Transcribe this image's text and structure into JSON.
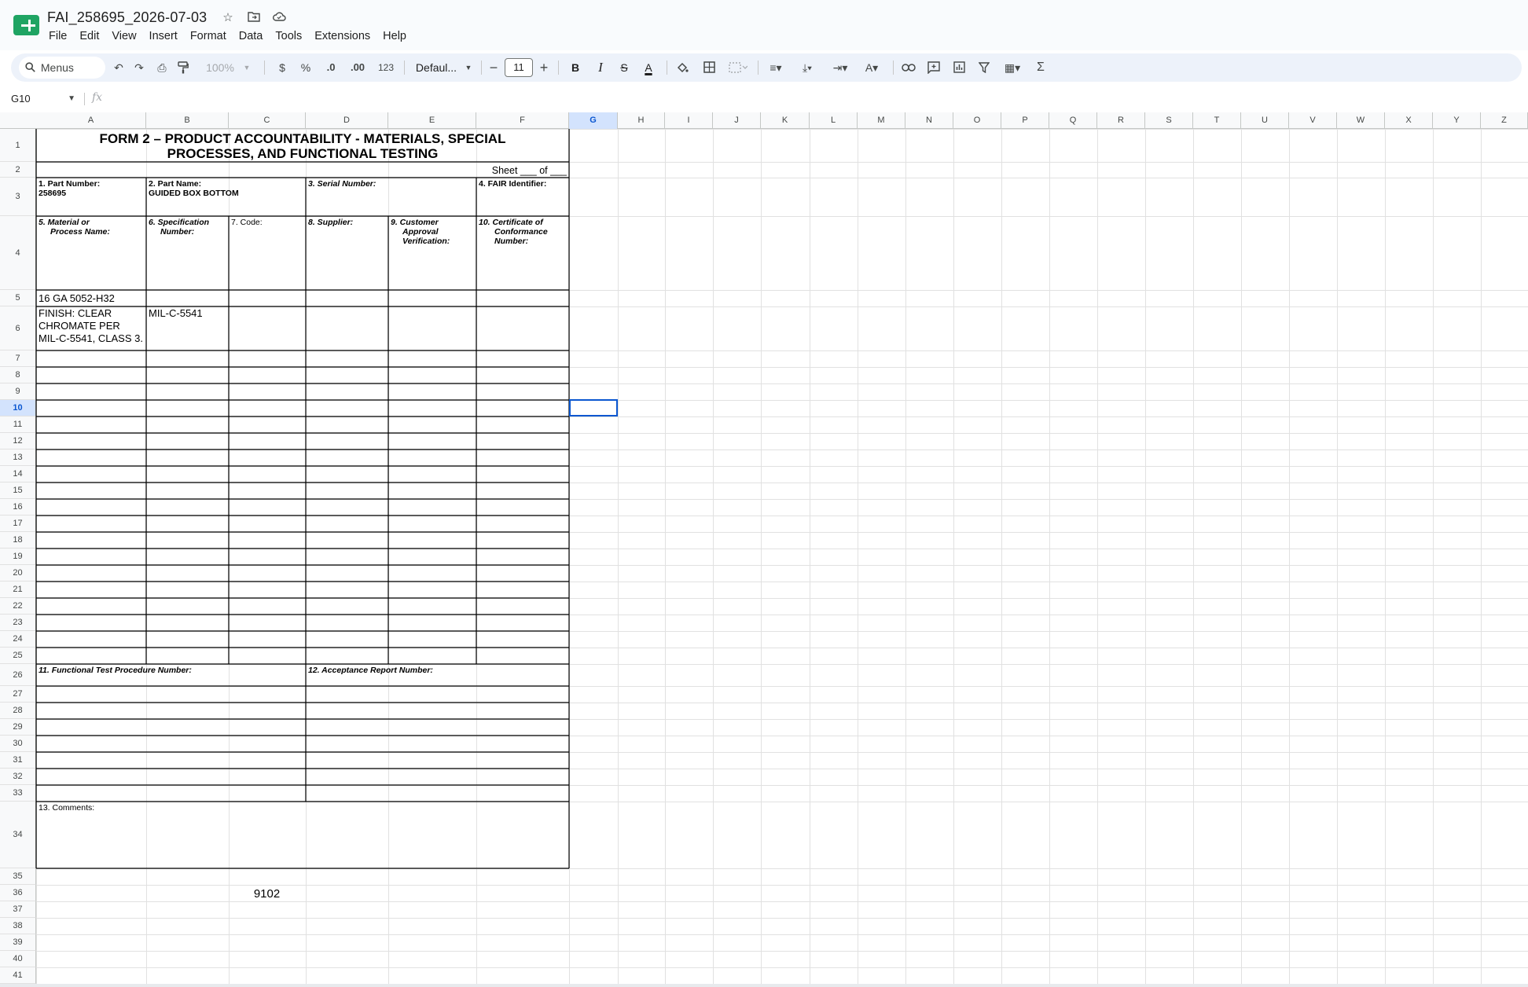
{
  "app": {
    "doc_title": "FAI_258695_2026-07-03",
    "menu": [
      "File",
      "Edit",
      "View",
      "Insert",
      "Format",
      "Data",
      "Tools",
      "Extensions",
      "Help"
    ]
  },
  "toolbar": {
    "menus_label": "Menus",
    "zoom": "100%",
    "currency": "$",
    "percent": "%",
    "decrease_decimal": ".0",
    "increase_decimal": ".00",
    "number_format": "123",
    "font_name": "Defaul...",
    "font_size": "11",
    "bold": "B",
    "italic": "I",
    "strike": "S",
    "text_color": "A",
    "sum": "Σ"
  },
  "formula_bar": {
    "name_box": "G10",
    "fx": "fx",
    "content": ""
  },
  "columns": [
    "A",
    "B",
    "C",
    "D",
    "E",
    "F",
    "G",
    "H",
    "I",
    "J",
    "K",
    "L",
    "M",
    "N",
    "O",
    "P",
    "Q",
    "R",
    "S",
    "T",
    "U",
    "V",
    "W",
    "X",
    "Y",
    "Z"
  ],
  "selected": {
    "col": "G",
    "row": "10"
  },
  "form": {
    "title_line1": "FORM 2 – PRODUCT ACCOUNTABILITY - MATERIALS, SPECIAL",
    "title_line2": "PROCESSES, AND FUNCTIONAL TESTING",
    "sheet_of": "Sheet ___ of ___",
    "part_number_label": "1.  Part Number:",
    "part_number_value": "258695",
    "part_name_label": "2.  Part Name:",
    "part_name_value": "GUIDED BOX BOTTOM",
    "serial_number_label": "3.  Serial Number:",
    "fair_identifier_label": "4.  FAIR Identifier:",
    "material_label_1": "5.  Material or",
    "material_label_2": "Process Name:",
    "spec_label_1": "6.  Specification",
    "spec_label_2": "Number:",
    "code_label": "7.  Code:",
    "supplier_label": "8.  Supplier:",
    "customer_label_1": "9.  Customer",
    "customer_label_2": "Approval",
    "customer_label_3": "Verification:",
    "coc_label_1": "10.  Certificate of",
    "coc_label_2": "Conformance",
    "coc_label_3": "Number:",
    "row5_material": "16 GA 5052-H32",
    "row6_material_1": "FINISH: CLEAR",
    "row6_material_2": "CHROMATE PER",
    "row6_material_3": "MIL-C-5541, CLASS 3.",
    "row6_spec": "MIL-C-5541",
    "functional_test_label": "11.  Functional Test Procedure Number:",
    "acceptance_report_label": "12.  Acceptance Report Number:",
    "comments_label": "13.  Comments:",
    "loose_value_c36": "9102"
  },
  "colors": {
    "selection": "#0b57d0",
    "header_bg": "#f8f9fa",
    "toolbar_bg": "#edf2fa",
    "sheets_green": "#1fa463"
  }
}
